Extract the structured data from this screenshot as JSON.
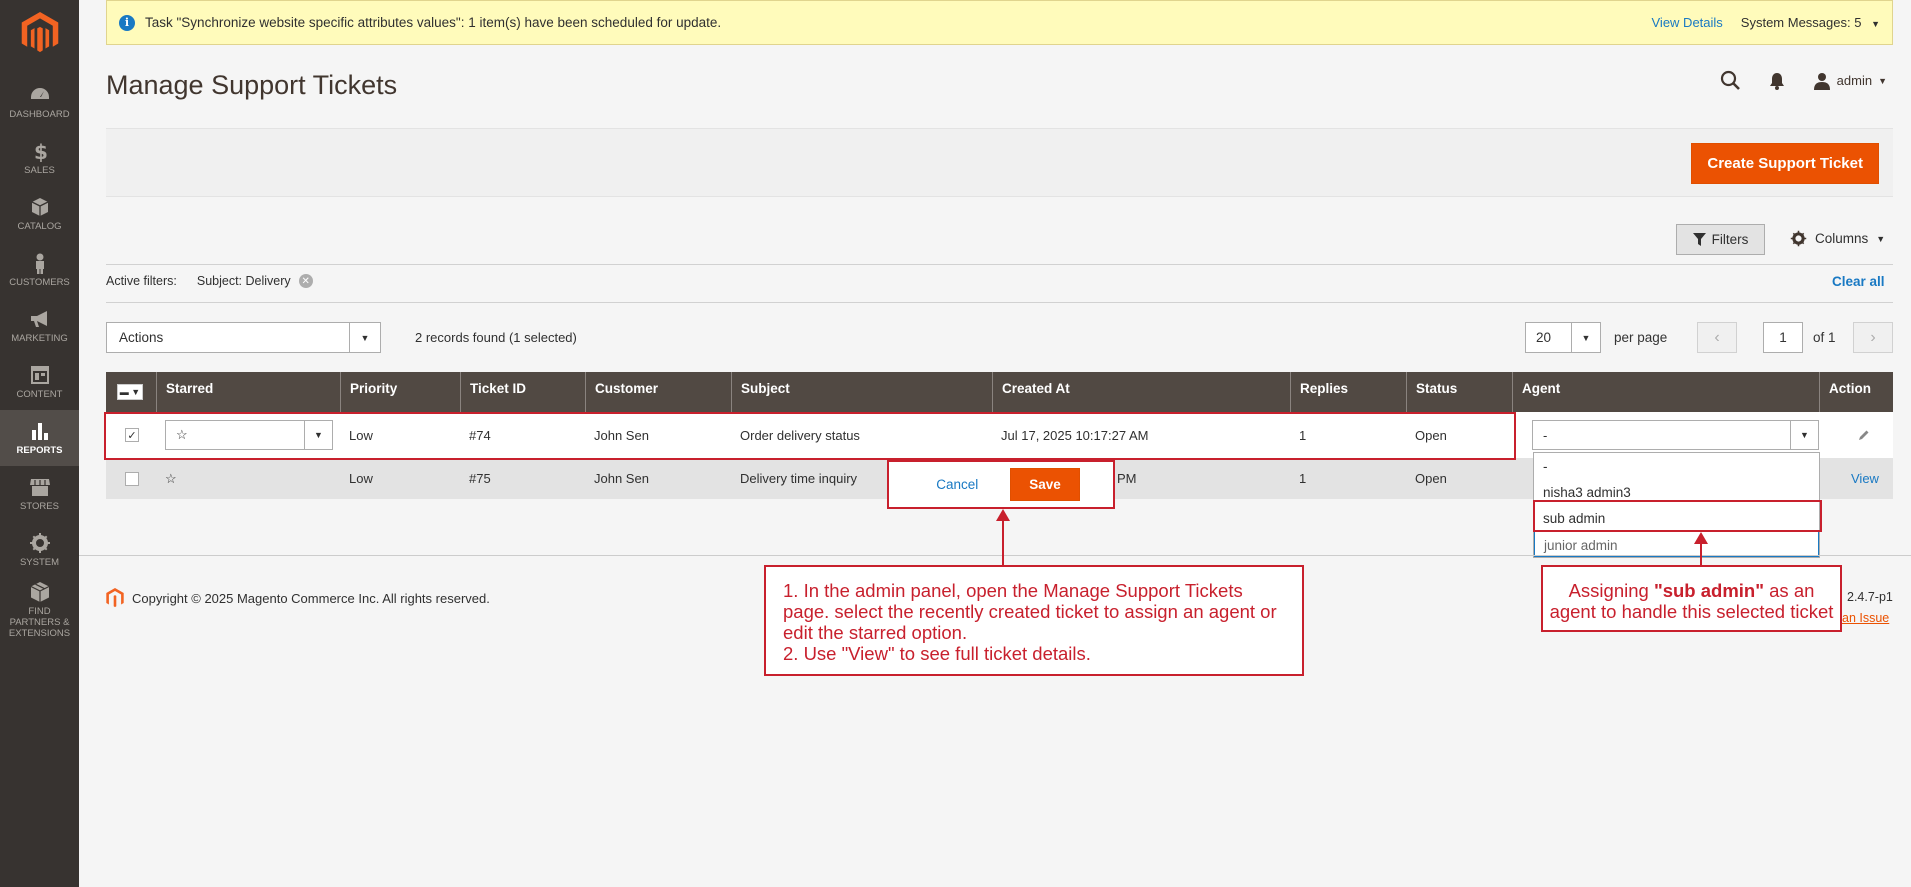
{
  "sidebar": {
    "items": [
      {
        "label": "DASHBOARD",
        "icon": "dashboard-icon"
      },
      {
        "label": "SALES",
        "icon": "dollar-icon"
      },
      {
        "label": "CATALOG",
        "icon": "cube-icon"
      },
      {
        "label": "CUSTOMERS",
        "icon": "person-icon"
      },
      {
        "label": "MARKETING",
        "icon": "megaphone-icon"
      },
      {
        "label": "CONTENT",
        "icon": "layout-icon"
      },
      {
        "label": "REPORTS",
        "icon": "bar-chart-icon"
      },
      {
        "label": "STORES",
        "icon": "store-icon"
      },
      {
        "label": "SYSTEM",
        "icon": "gear-icon"
      },
      {
        "label": "FIND PARTNERS & EXTENSIONS",
        "icon": "box-icon"
      }
    ],
    "active": "REPORTS"
  },
  "message_bar": {
    "text": "Task \"Synchronize website specific attributes values\": 1 item(s) have been scheduled for update.",
    "view_details": "View Details",
    "system_messages": "System Messages: 5"
  },
  "header": {
    "title": "Manage Support Tickets",
    "user": "admin"
  },
  "page_actions": {
    "create_button": "Create Support Ticket"
  },
  "grid_controls": {
    "filters_label": "Filters",
    "columns_label": "Columns",
    "active_filters_label": "Active filters:",
    "active_filter_value": "Subject: Delivery",
    "clear_all": "Clear all",
    "actions_label": "Actions",
    "records_found": "2 records found (1 selected)",
    "per_page_value": "20",
    "per_page_label": "per page",
    "current_page": "1",
    "page_of": "of 1"
  },
  "table": {
    "columns": [
      "Starred",
      "Priority",
      "Ticket ID",
      "Customer",
      "Subject",
      "Created At",
      "Replies",
      "Status",
      "Agent",
      "Action"
    ],
    "rows": [
      {
        "starred": "☆",
        "priority": "Low",
        "ticket_id": "#74",
        "customer": "John Sen",
        "subject": "Order delivery status",
        "created_at": "Jul 17, 2025 10:17:27 AM",
        "replies": "1",
        "status": "Open",
        "agent": "-",
        "checked": true
      },
      {
        "starred": "☆",
        "priority": "Low",
        "ticket_id": "#75",
        "customer": "John Sen",
        "subject": "Delivery time inquiry",
        "created_at": "PM",
        "replies": "1",
        "status": "Open",
        "action": "View",
        "checked": false
      }
    ],
    "agent_options": [
      "-",
      "nisha3 admin3",
      "sub admin",
      "junior admin"
    ]
  },
  "inline_edit": {
    "cancel": "Cancel",
    "save": "Save"
  },
  "footer": {
    "copyright": "Copyright © 2025 Magento Commerce Inc. All rights reserved.",
    "version": "2.4.7-p1",
    "report_issue": "an Issue"
  },
  "annotations": {
    "note1_line1": "1. In the admin panel, open the Manage Support Tickets",
    "note1_line2": "page. select the recently created ticket to assign an agent or",
    "note1_line3": "edit the starred option.",
    "note1_line4": "2. Use \"View\" to see full ticket details.",
    "note2_pre": "Assigning ",
    "note2_bold": "\"sub admin\"",
    "note2_post": " as an",
    "note2_line2": "agent to handle this selected ticket"
  },
  "colors": {
    "accent": "#eb5202",
    "annotation": "#c8202d",
    "sidebar": "#373330",
    "table_header": "#514943",
    "link": "#1979c3"
  }
}
